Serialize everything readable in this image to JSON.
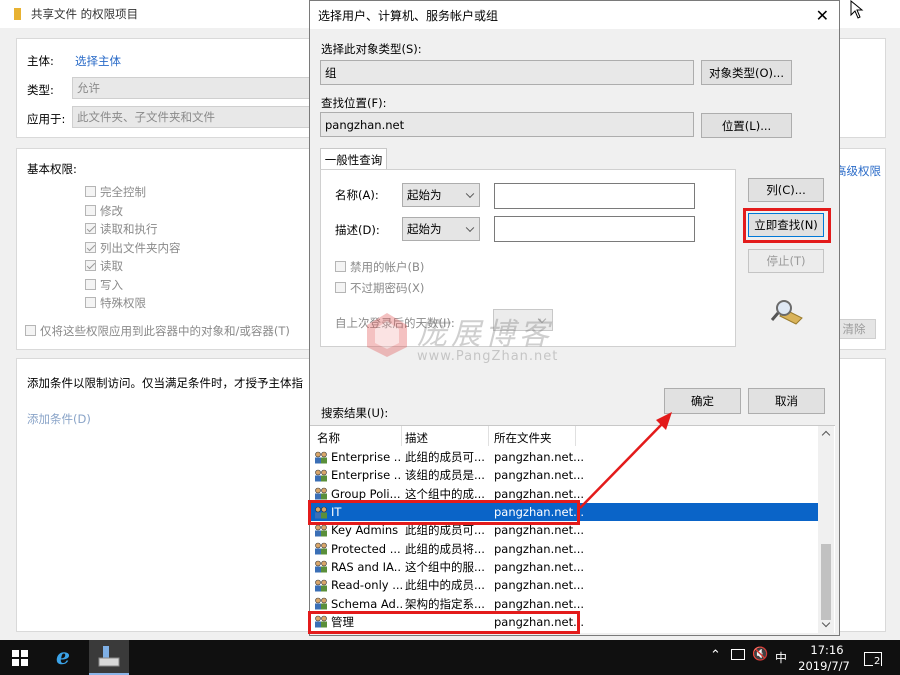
{
  "bg_window": {
    "title": "共享文件 的权限项目",
    "principal_label": "主体:",
    "principal_link": "选择主体",
    "type_label": "类型:",
    "type_value": "允许",
    "applies_label": "应用于:",
    "applies_value": "此文件夹、子文件夹和文件",
    "basic_perms_title": "基本权限:",
    "perms": [
      {
        "label": "完全控制",
        "checked": false
      },
      {
        "label": "修改",
        "checked": false
      },
      {
        "label": "读取和执行",
        "checked": true
      },
      {
        "label": "列出文件夹内容",
        "checked": true
      },
      {
        "label": "读取",
        "checked": true
      },
      {
        "label": "写入",
        "checked": false
      },
      {
        "label": "特殊权限",
        "checked": false
      }
    ],
    "apply_only_label": "仅将这些权限应用到此容器中的对象和/或容器(T)",
    "advanced_link": "高级权限",
    "clear_all_button": "清除",
    "condition_text": "添加条件以限制访问。仅当满足条件时，才授予主体指",
    "add_condition_link": "添加条件(D)"
  },
  "dialog": {
    "title": "选择用户、计算机、服务帐户或组",
    "object_type_label": "选择此对象类型(S):",
    "object_type_value": "组",
    "object_type_button": "对象类型(O)...",
    "location_label": "查找位置(F):",
    "location_value": "pangzhan.net",
    "location_button": "位置(L)...",
    "tab_label": "一般性查询",
    "name_label": "名称(A):",
    "name_mode": "起始为",
    "desc_label": "描述(D):",
    "desc_mode": "起始为",
    "disabled_accounts": "禁用的帐户(B)",
    "no_expire_pwd": "不过期密码(X)",
    "days_since_login": "自上次登录后的天数(I):",
    "columns_button": "列(C)...",
    "find_now_button": "立即查找(N)",
    "stop_button": "停止(T)",
    "ok_button": "确定",
    "cancel_button": "取消",
    "results_label": "搜索结果(U):",
    "watermark_text": "庞展博客",
    "watermark_url": "www.PangZhan.net",
    "results_headers": [
      "名称",
      "描述",
      "所在文件夹"
    ],
    "results": [
      {
        "name": "Enterprise ...",
        "desc": "此组的成员可...",
        "folder": "pangzhan.net...",
        "selected": false
      },
      {
        "name": "Enterprise ...",
        "desc": "该组的成员是...",
        "folder": "pangzhan.net...",
        "selected": false
      },
      {
        "name": "Group Poli...",
        "desc": "这个组中的成...",
        "folder": "pangzhan.net...",
        "selected": false
      },
      {
        "name": "IT",
        "desc": "",
        "folder": "pangzhan.net...",
        "selected": true
      },
      {
        "name": "Key Admins",
        "desc": "此组的成员可...",
        "folder": "pangzhan.net...",
        "selected": false
      },
      {
        "name": "Protected ...",
        "desc": "此组的成员将...",
        "folder": "pangzhan.net...",
        "selected": false
      },
      {
        "name": "RAS and IA...",
        "desc": "这个组中的服...",
        "folder": "pangzhan.net...",
        "selected": false
      },
      {
        "name": "Read-only ...",
        "desc": "此组中的成员...",
        "folder": "pangzhan.net...",
        "selected": false
      },
      {
        "name": "Schema Ad...",
        "desc": "架构的指定系...",
        "folder": "pangzhan.net...",
        "selected": false
      },
      {
        "name": "管理",
        "desc": "",
        "folder": "pangzhan.net...",
        "selected": false
      }
    ]
  },
  "taskbar": {
    "time": "17:16",
    "date": "2019/7/7",
    "ime": "中",
    "notif_count": "2"
  },
  "colors": {
    "highlight": "#e31b1b",
    "selection": "#0a64c8",
    "arrow": "#e31b1b"
  }
}
